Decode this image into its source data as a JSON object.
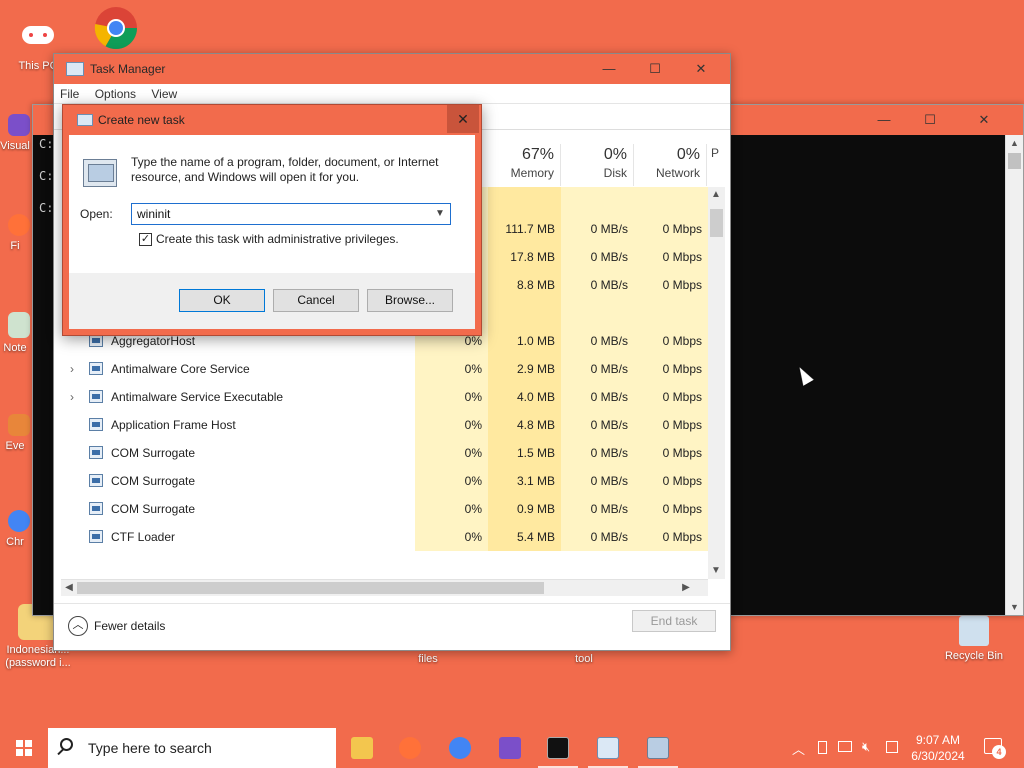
{
  "desktop": {
    "icons": [
      {
        "label": "This PC"
      },
      {
        "label": ""
      },
      {
        "label": "Visual"
      },
      {
        "label": "Fi"
      },
      {
        "label": "Note"
      },
      {
        "label": "Eve"
      },
      {
        "label": "Chr"
      },
      {
        "label": "Indonesian... (password i..."
      },
      {
        "label": "files"
      },
      {
        "label": "tool"
      },
      {
        "label": "Recycle Bin"
      }
    ]
  },
  "console": {
    "prompts": [
      "C:",
      "C:",
      "C:"
    ],
    "minimize": "—",
    "maximize": "☐",
    "close": "✕"
  },
  "task_manager": {
    "title": "Task Manager",
    "menu": [
      "File",
      "Options",
      "View"
    ],
    "columns": [
      {
        "pct": "67%",
        "name": "Memory"
      },
      {
        "pct": "0%",
        "name": "Disk"
      },
      {
        "pct": "0%",
        "name": "Network"
      },
      {
        "pct": "",
        "name": "P"
      }
    ],
    "rows": [
      {
        "name": "",
        "cpu": "",
        "mem": "",
        "disk": "",
        "net": ""
      },
      {
        "name": "",
        "cpu": "",
        "mem": "111.7 MB",
        "disk": "0 MB/s",
        "net": "0 Mbps"
      },
      {
        "name": "",
        "cpu": "",
        "mem": "17.8 MB",
        "disk": "0 MB/s",
        "net": "0 Mbps"
      },
      {
        "name": "",
        "cpu": "",
        "mem": "8.8 MB",
        "disk": "0 MB/s",
        "net": "0 Mbps"
      },
      {
        "name": "",
        "cpu": "",
        "mem": "",
        "disk": "",
        "net": ""
      },
      {
        "name": "AggregatorHost",
        "cpu": "0%",
        "mem": "1.0 MB",
        "disk": "0 MB/s",
        "net": "0 Mbps"
      },
      {
        "name": "Antimalware Core Service",
        "cpu": "0%",
        "mem": "2.9 MB",
        "disk": "0 MB/s",
        "net": "0 Mbps",
        "expand": true
      },
      {
        "name": "Antimalware Service Executable",
        "cpu": "0%",
        "mem": "4.0 MB",
        "disk": "0 MB/s",
        "net": "0 Mbps",
        "expand": true
      },
      {
        "name": "Application Frame Host",
        "cpu": "0%",
        "mem": "4.8 MB",
        "disk": "0 MB/s",
        "net": "0 Mbps"
      },
      {
        "name": "COM Surrogate",
        "cpu": "0%",
        "mem": "1.5 MB",
        "disk": "0 MB/s",
        "net": "0 Mbps"
      },
      {
        "name": "COM Surrogate",
        "cpu": "0%",
        "mem": "3.1 MB",
        "disk": "0 MB/s",
        "net": "0 Mbps"
      },
      {
        "name": "COM Surrogate",
        "cpu": "0%",
        "mem": "0.9 MB",
        "disk": "0 MB/s",
        "net": "0 Mbps"
      },
      {
        "name": "CTF Loader",
        "cpu": "0%",
        "mem": "5.4 MB",
        "disk": "0 MB/s",
        "net": "0 Mbps"
      }
    ],
    "fewer_details": "Fewer details",
    "end_task": "End task",
    "minimize": "—",
    "maximize": "☐",
    "close": "✕"
  },
  "dialog": {
    "title": "Create new task",
    "close": "✕",
    "description": "Type the name of a program, folder, document, or Internet resource, and Windows will open it for you.",
    "open_label": "Open:",
    "open_value": "wininit",
    "checkbox_label": "Create this task with administrative privileges.",
    "checkbox_checked": true,
    "ok": "OK",
    "cancel": "Cancel",
    "browse": "Browse..."
  },
  "taskbar": {
    "search_placeholder": "Type here to search",
    "time": "9:07 AM",
    "date": "6/30/2024",
    "notification_count": "4"
  },
  "colors": {
    "desktop": "#F26B4C",
    "highlight_cell": "#FFF4C4",
    "highlight_cell_strong": "#FFE9A0"
  }
}
